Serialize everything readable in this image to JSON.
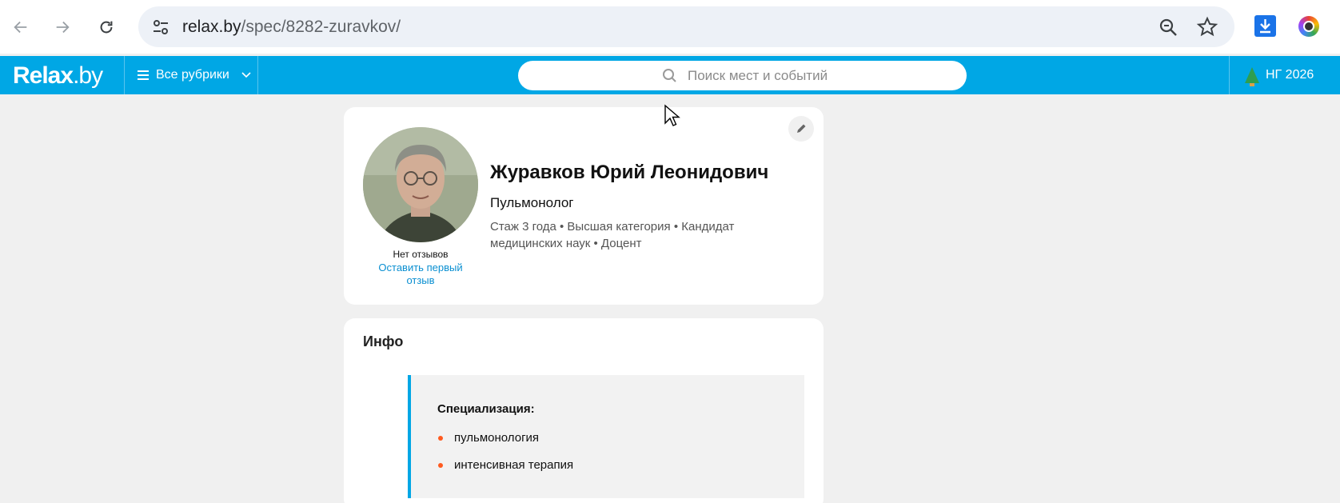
{
  "browser": {
    "url_host": "relax.by",
    "url_path": "/spec/8282-zuravkov/",
    "icons": [
      "back-arrow-icon",
      "forward-arrow-icon",
      "reload-icon",
      "site-settings-icon",
      "zoom-icon",
      "bookmark-star-icon",
      "download-extension-icon",
      "colorful-extension-icon"
    ]
  },
  "header": {
    "logo_main": "Relax",
    "logo_tld": ".by",
    "rubrics_label": "Все рубрики",
    "search_placeholder": "Поиск мест и событий",
    "ng_label": "НГ 2026",
    "brand_color": "#00a7e5"
  },
  "profile": {
    "name": "Журавков Юрий Леонидович",
    "specialty": "Пульмонолог",
    "meta": "Стаж 3 года  •  Высшая категория • Кандидат медицинских наук • Доцент",
    "no_reviews": "Нет отзывов",
    "leave_review": "Оставить первый отзыв"
  },
  "info": {
    "title": "Инфо",
    "spec_label": "Специализация:",
    "items": [
      "пульмонология",
      "интенсивная терапия"
    ],
    "bullet_color": "#ff5a1f"
  }
}
